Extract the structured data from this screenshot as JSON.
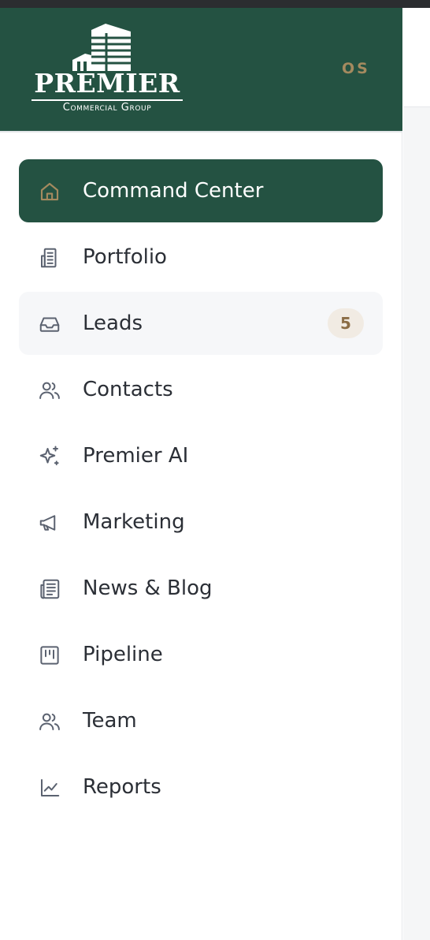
{
  "brand": {
    "name": "Premier",
    "subtitle": "Commercial Group",
    "user_initials": "OS",
    "colors": {
      "primary": "#245242",
      "accent": "#a48a5f",
      "badge_bg": "#f1ebe3"
    }
  },
  "nav": {
    "items": [
      {
        "label": "Command Center",
        "icon": "home-icon",
        "active": true
      },
      {
        "label": "Portfolio",
        "icon": "building-icon"
      },
      {
        "label": "Leads",
        "icon": "inbox-icon",
        "badge": "5"
      },
      {
        "label": "Contacts",
        "icon": "users-icon"
      },
      {
        "label": "Premier AI",
        "icon": "sparkles-icon"
      },
      {
        "label": "Marketing",
        "icon": "megaphone-icon"
      },
      {
        "label": "News & Blog",
        "icon": "newspaper-icon"
      },
      {
        "label": "Pipeline",
        "icon": "kanban-icon"
      },
      {
        "label": "Team",
        "icon": "users-icon"
      },
      {
        "label": "Reports",
        "icon": "line-chart-icon"
      }
    ]
  }
}
